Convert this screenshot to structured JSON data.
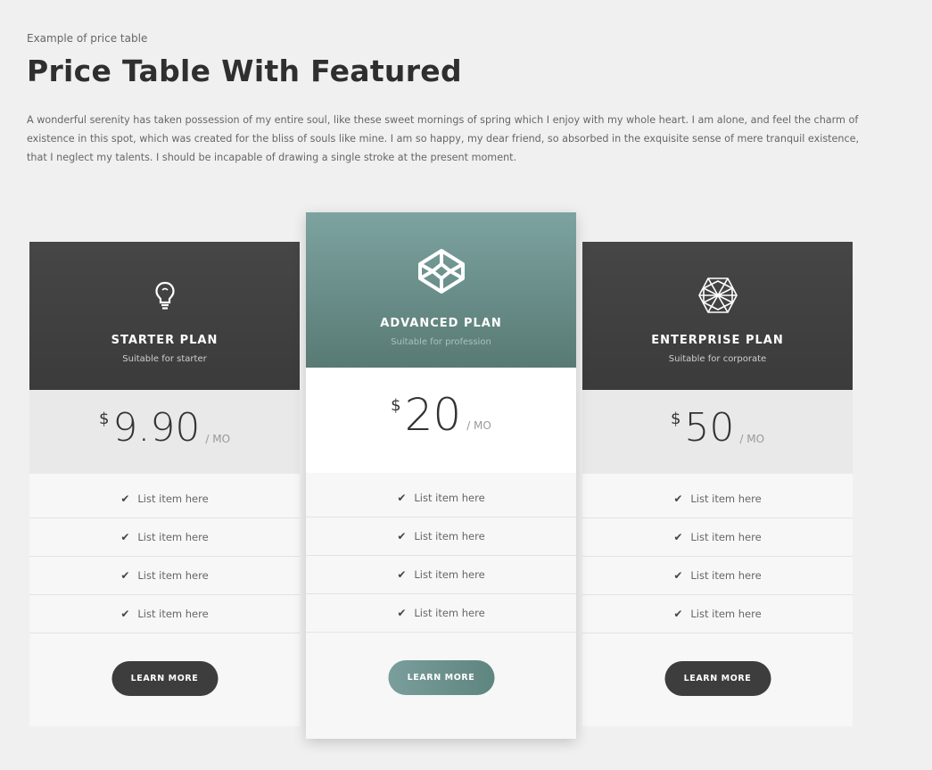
{
  "header": {
    "eyebrow": "Example of price table",
    "title": "Price Table With Featured",
    "intro": "A wonderful serenity has taken possession of my entire soul, like these sweet mornings of spring which I enjoy with my whole heart. I am alone, and feel the charm of existence in this spot, which was created for the bliss of souls like mine. I am so happy, my dear friend, so absorbed in the exquisite sense of mere tranquil existence, that I neglect my talents. I should be incapable of drawing a single stroke at the present moment."
  },
  "plans": [
    {
      "name": "STARTER PLAN",
      "subtitle": "Suitable for starter",
      "icon": "lightbulb-icon",
      "currency": "$",
      "amount": "9.90",
      "period": "/ MO",
      "features": [
        "List item here",
        "List item here",
        "List item here",
        "List item here"
      ],
      "button": "LEARN MORE",
      "featured": false
    },
    {
      "name": "ADVANCED PLAN",
      "subtitle": "Suitable for profession",
      "icon": "codepen-icon",
      "currency": "$",
      "amount": "20",
      "period": "/ MO",
      "features": [
        "List item here",
        "List item here",
        "List item here",
        "List item here"
      ],
      "button": "LEARN MORE",
      "featured": true
    },
    {
      "name": "ENTERPRISE PLAN",
      "subtitle": "Suitable for corporate",
      "icon": "polyhedron-icon",
      "currency": "$",
      "amount": "50",
      "period": "/ MO",
      "features": [
        "List item here",
        "List item here",
        "List item here",
        "List item here"
      ],
      "button": "LEARN MORE",
      "featured": false
    }
  ],
  "colors": {
    "dark_header": "#3f3f3f",
    "featured_header": "#6f9591",
    "page_background": "#f0f0f0"
  }
}
